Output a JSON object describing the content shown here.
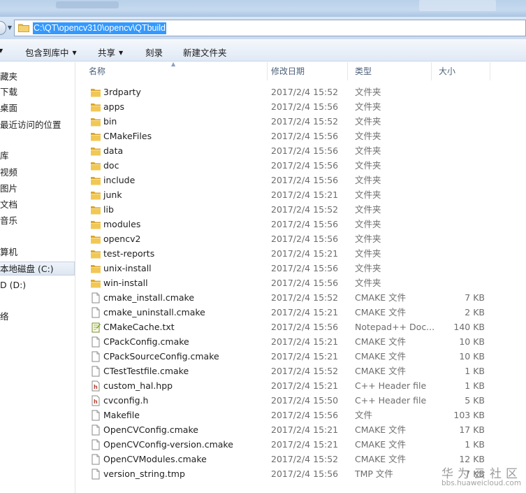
{
  "address": {
    "path": "C:\\QT\\opencv310\\opencv\\QTbuild"
  },
  "toolbar": {
    "include_library": "包含到库中",
    "share": "共享",
    "burn": "刻录",
    "new_folder": "新建文件夹"
  },
  "nav": {
    "items": [
      {
        "label": "藏夹"
      },
      {
        "label": "下载"
      },
      {
        "label": "桌面"
      },
      {
        "label": "最近访问的位置"
      },
      {
        "label": "库"
      },
      {
        "label": "视频"
      },
      {
        "label": "图片"
      },
      {
        "label": "文档"
      },
      {
        "label": "音乐"
      },
      {
        "label": "算机"
      },
      {
        "label": "本地磁盘 (C:)"
      },
      {
        "label": "D (D:)"
      },
      {
        "label": "络"
      }
    ]
  },
  "columns": {
    "name": "名称",
    "date": "修改日期",
    "type": "类型",
    "size": "大小"
  },
  "files": [
    {
      "name": "3rdparty",
      "date": "2017/2/4 15:52",
      "type": "文件夹",
      "size": "",
      "icon": "folder-icon"
    },
    {
      "name": "apps",
      "date": "2017/2/4 15:56",
      "type": "文件夹",
      "size": "",
      "icon": "folder-icon"
    },
    {
      "name": "bin",
      "date": "2017/2/4 15:52",
      "type": "文件夹",
      "size": "",
      "icon": "folder-icon"
    },
    {
      "name": "CMakeFiles",
      "date": "2017/2/4 15:56",
      "type": "文件夹",
      "size": "",
      "icon": "folder-icon"
    },
    {
      "name": "data",
      "date": "2017/2/4 15:56",
      "type": "文件夹",
      "size": "",
      "icon": "folder-icon"
    },
    {
      "name": "doc",
      "date": "2017/2/4 15:56",
      "type": "文件夹",
      "size": "",
      "icon": "folder-icon"
    },
    {
      "name": "include",
      "date": "2017/2/4 15:56",
      "type": "文件夹",
      "size": "",
      "icon": "folder-icon"
    },
    {
      "name": "junk",
      "date": "2017/2/4 15:21",
      "type": "文件夹",
      "size": "",
      "icon": "folder-icon"
    },
    {
      "name": "lib",
      "date": "2017/2/4 15:52",
      "type": "文件夹",
      "size": "",
      "icon": "folder-icon"
    },
    {
      "name": "modules",
      "date": "2017/2/4 15:56",
      "type": "文件夹",
      "size": "",
      "icon": "folder-icon"
    },
    {
      "name": "opencv2",
      "date": "2017/2/4 15:56",
      "type": "文件夹",
      "size": "",
      "icon": "folder-icon"
    },
    {
      "name": "test-reports",
      "date": "2017/2/4 15:21",
      "type": "文件夹",
      "size": "",
      "icon": "folder-icon"
    },
    {
      "name": "unix-install",
      "date": "2017/2/4 15:56",
      "type": "文件夹",
      "size": "",
      "icon": "folder-icon"
    },
    {
      "name": "win-install",
      "date": "2017/2/4 15:56",
      "type": "文件夹",
      "size": "",
      "icon": "folder-icon"
    },
    {
      "name": "cmake_install.cmake",
      "date": "2017/2/4 15:52",
      "type": "CMAKE 文件",
      "size": "7 KB",
      "icon": "file-icon"
    },
    {
      "name": "cmake_uninstall.cmake",
      "date": "2017/2/4 15:21",
      "type": "CMAKE 文件",
      "size": "2 KB",
      "icon": "file-icon"
    },
    {
      "name": "CMakeCache.txt",
      "date": "2017/2/4 15:56",
      "type": "Notepad++ Doc...",
      "size": "140 KB",
      "icon": "notepad-icon"
    },
    {
      "name": "CPackConfig.cmake",
      "date": "2017/2/4 15:21",
      "type": "CMAKE 文件",
      "size": "10 KB",
      "icon": "file-icon"
    },
    {
      "name": "CPackSourceConfig.cmake",
      "date": "2017/2/4 15:21",
      "type": "CMAKE 文件",
      "size": "10 KB",
      "icon": "file-icon"
    },
    {
      "name": "CTestTestfile.cmake",
      "date": "2017/2/4 15:52",
      "type": "CMAKE 文件",
      "size": "1 KB",
      "icon": "file-icon"
    },
    {
      "name": "custom_hal.hpp",
      "date": "2017/2/4 15:21",
      "type": "C++ Header file",
      "size": "1 KB",
      "icon": "header-file-icon"
    },
    {
      "name": "cvconfig.h",
      "date": "2017/2/4 15:50",
      "type": "C++ Header file",
      "size": "5 KB",
      "icon": "header-file-icon"
    },
    {
      "name": "Makefile",
      "date": "2017/2/4 15:56",
      "type": "文件",
      "size": "103 KB",
      "icon": "file-icon"
    },
    {
      "name": "OpenCVConfig.cmake",
      "date": "2017/2/4 15:21",
      "type": "CMAKE 文件",
      "size": "17 KB",
      "icon": "file-icon"
    },
    {
      "name": "OpenCVConfig-version.cmake",
      "date": "2017/2/4 15:21",
      "type": "CMAKE 文件",
      "size": "1 KB",
      "icon": "file-icon"
    },
    {
      "name": "OpenCVModules.cmake",
      "date": "2017/2/4 15:52",
      "type": "CMAKE 文件",
      "size": "12 KB",
      "icon": "file-icon"
    },
    {
      "name": "version_string.tmp",
      "date": "2017/2/4 15:56",
      "type": "TMP 文件",
      "size": "7 KB",
      "icon": "file-icon"
    }
  ],
  "watermark": {
    "title": "华为云社区",
    "url": "bbs.huaweicloud.com"
  },
  "colors": {
    "selection": "#3399ff",
    "folder": "#e8b83a",
    "header_text": "#4c607a"
  }
}
